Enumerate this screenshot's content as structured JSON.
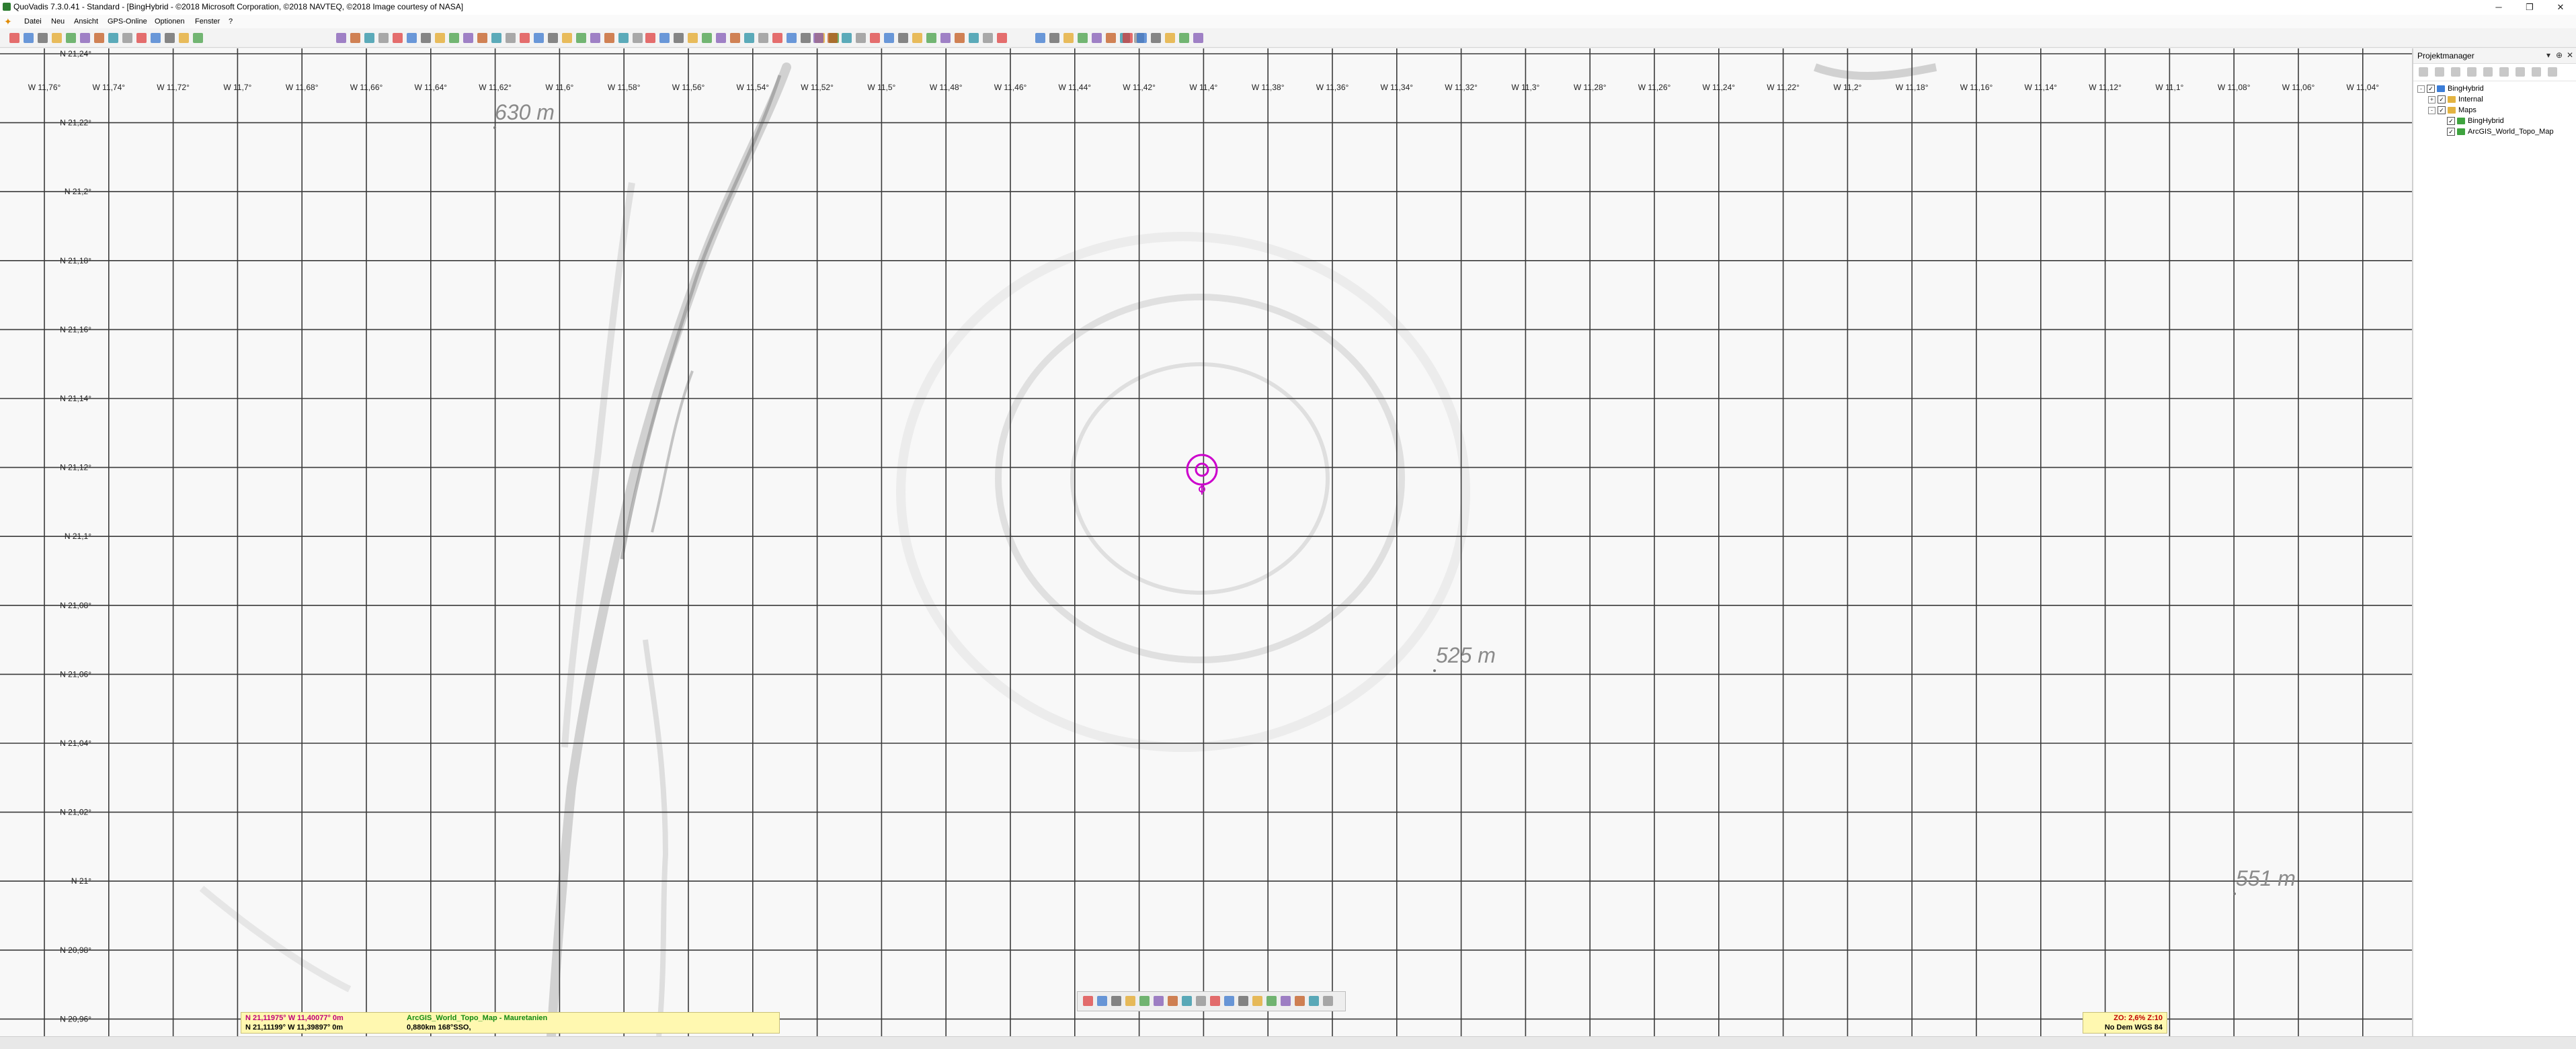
{
  "window": {
    "title": "QuoVadis 7.3.0.41 - Standard - [BingHybrid - ©2018 Microsoft Corporation, ©2018 NAVTEQ, ©2018 Image courtesy of NASA]",
    "minimize": "─",
    "maximize": "❐",
    "close": "✕"
  },
  "menu": {
    "items": [
      "Datei",
      "Neu",
      "Ansicht",
      "GPS-Online",
      "Optionen",
      "Fenster",
      "?"
    ]
  },
  "map": {
    "longitude_labels": [
      "W 11,76°",
      "W 11,74°",
      "W 11,72°",
      "W 11,7°",
      "W 11,68°",
      "W 11,66°",
      "W 11,64°",
      "W 11,62°",
      "W 11,6°",
      "W 11,58°",
      "W 11,56°",
      "W 11,54°",
      "W 11,52°",
      "W 11,5°",
      "W 11,48°",
      "W 11,46°",
      "W 11,44°",
      "W 11,42°",
      "W 11,4°",
      "W 11,38°",
      "W 11,36°",
      "W 11,34°",
      "W 11,32°",
      "W 11,3°",
      "W 11,28°",
      "W 11,26°",
      "W 11,24°",
      "W 11,22°",
      "W 11,2°",
      "W 11,18°",
      "W 11,16°",
      "W 11,14°",
      "W 11,12°",
      "W 11,1°",
      "W 11,08°",
      "W 11,06°",
      "W 11,04°"
    ],
    "latitude_labels": [
      "N 21,24°",
      "N 21,22°",
      "N 21,2°",
      "N 21,18°",
      "N 21,16°",
      "N 21,14°",
      "N 21,12°",
      "N 21,1°",
      "N 21,08°",
      "N 21,06°",
      "N 21,04°",
      "N 21,02°",
      "N 21°",
      "N 20,98°",
      "N 20,96°"
    ],
    "elevation_labels": [
      "630 m",
      "525 m",
      "551 m"
    ],
    "target_color": "#cc00cc",
    "grid_color": "#3a3a3a"
  },
  "status": {
    "cursor_position": "N 21,11975° W 11,40077° 0m",
    "gps_position": "N 21,11199° W 11,39897° 0m",
    "map_name": "ArcGIS_World_Topo_Map - Mauretanien",
    "distance": "0,880km 168°SSO,",
    "zoom": "ZO: 2,6% Z:10",
    "dem": "No Dem WGS 84"
  },
  "project_manager": {
    "title": "Projektmanager",
    "pin": "⊕",
    "close": "✕",
    "tree": [
      {
        "label": "BingHybrid",
        "level": 0,
        "expander": "-",
        "checked": true,
        "icon_color": "#3b7dd8"
      },
      {
        "label": "Internal",
        "level": 1,
        "expander": "+",
        "checked": true,
        "icon_color": "#e3b341"
      },
      {
        "label": "Maps",
        "level": 1,
        "expander": "-",
        "checked": true,
        "icon_color": "#e3b341"
      },
      {
        "label": "BingHybrid",
        "level": 2,
        "expander": "",
        "checked": true,
        "icon_color": "#3fa33f"
      },
      {
        "label": "ArcGIS_World_Topo_Map",
        "level": 2,
        "expander": "",
        "checked": true,
        "icon_color": "#3fa33f"
      }
    ]
  }
}
